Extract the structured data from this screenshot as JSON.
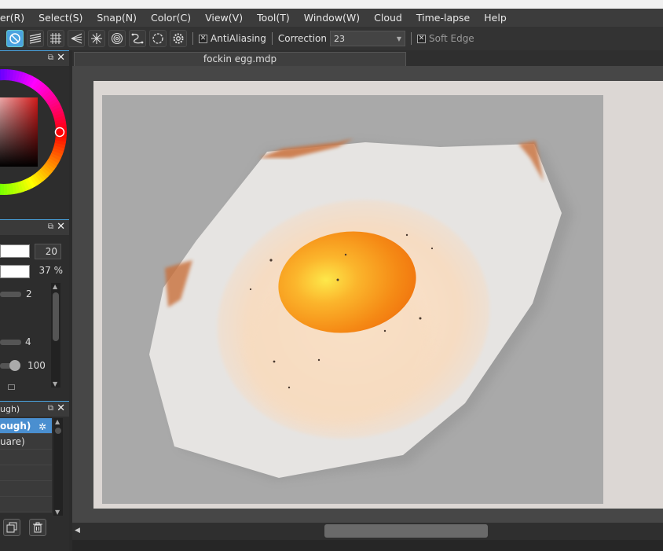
{
  "menubar": {
    "items": [
      "ter(R)",
      "Select(S)",
      "Snap(N)",
      "Color(C)",
      "View(V)",
      "Tool(T)",
      "Window(W)",
      "Cloud",
      "Time-lapse",
      "Help"
    ]
  },
  "toolbar": {
    "antialiasing_label": "AntiAliasing",
    "antialiasing_checked": "✕",
    "correction_label": "Correction",
    "correction_value": "23",
    "softedge_label": "Soft Edge",
    "softedge_checked": "✕"
  },
  "document": {
    "tab_title": "fockin egg.mdp"
  },
  "brush_panel": {
    "size_value": "20",
    "opacity_value": "37 %",
    "slider1_value": "2",
    "slider2_value": "4",
    "slider3_value": "100"
  },
  "layers_panel": {
    "header_title": "ugh)",
    "layers": [
      {
        "label": "ough)",
        "selected": true
      },
      {
        "label": "uare)",
        "selected": false
      },
      {
        "label": "",
        "selected": false
      },
      {
        "label": "",
        "selected": false
      },
      {
        "label": "",
        "selected": false
      },
      {
        "label": "",
        "selected": false
      }
    ]
  },
  "colors": {
    "accent": "#4aa3df",
    "canvas_bg": "#a9a9a9",
    "egg_yolk": "#f59a1b"
  }
}
